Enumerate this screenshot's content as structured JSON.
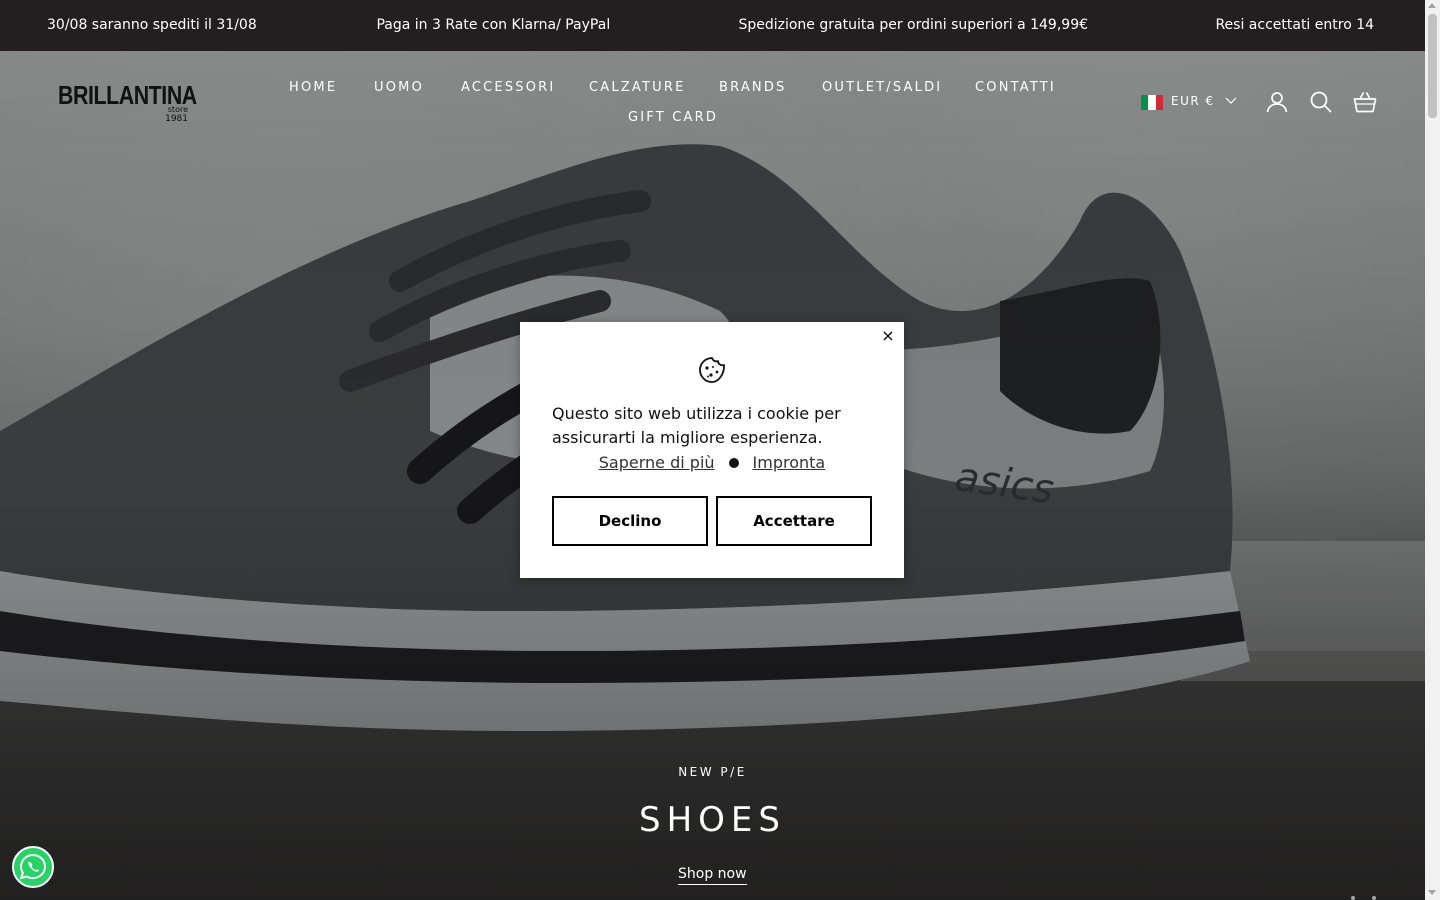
{
  "announcement": {
    "items": [
      "30/08 saranno spediti il 31/08",
      "⁣ Paga in 3 Rate con Klarna/ PayPal",
      "⁣ Spedizione gratuita per ordini superiori a 149,99€",
      "⁣ Resi accettati entro 14"
    ]
  },
  "header": {
    "logo": {
      "main": "BRILLANTINA",
      "sub1": "store",
      "sub2": "1981"
    },
    "nav": [
      "HOME",
      "UOMO",
      "ACCESSORI",
      "CALZATURE",
      "BRANDS",
      "OUTLET/SALDI",
      "CONTATTI",
      "GIFT CARD"
    ],
    "currency": {
      "label": "EUR €",
      "flag_colors": [
        "#009246",
        "#ffffff",
        "#ce2b37"
      ]
    },
    "icons": [
      "account-icon",
      "search-icon",
      "cart-icon"
    ]
  },
  "hero": {
    "eyebrow": "NEW P/E",
    "title": "SHOES",
    "cta": "Shop now"
  },
  "cookie_banner": {
    "close": "×",
    "message": "Questo sito web utilizza i cookie per assicurarti la migliore esperienza.",
    "learn_more": "Saperne di più",
    "imprint": "Impronta",
    "decline": "Declino",
    "accept": "Accettare"
  },
  "colors": {
    "announcement_bg": "#231f20",
    "whatsapp_green": "#25d366"
  }
}
